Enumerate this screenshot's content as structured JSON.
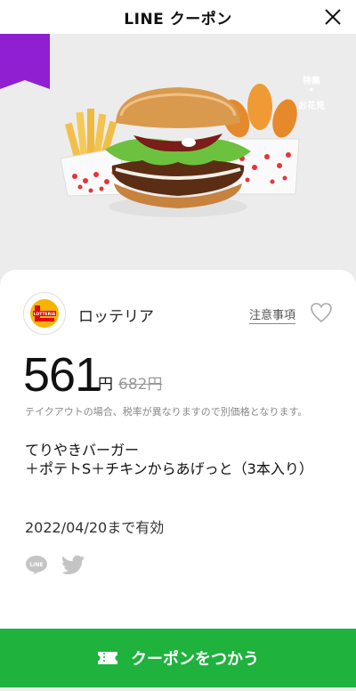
{
  "header": {
    "title": "LINE クーポン"
  },
  "ribbon": {
    "top_text": "特集",
    "star": "★",
    "bottom_text": "お花見"
  },
  "hero": {
    "brand_text": "LOTTERIA"
  },
  "coupon": {
    "shop_name": "ロッテリア",
    "logo_text": "LOTTERIA",
    "notice_label": "注意事項",
    "price": "561",
    "price_unit": "円",
    "original_price": "682円",
    "tax_note": "テイクアウトの場合、税率が異なりますので別価格となります。",
    "product_line1": "てりやきバーガー",
    "product_line2": "＋ポテトS＋チキンからあげっと（3本入り）",
    "expiry": "2022/04/20まで有効"
  },
  "share": {
    "line_icon_text": "LINE"
  },
  "button": {
    "label": "クーポンをつかう"
  },
  "colors": {
    "accent_green": "#1fb23d",
    "ribbon_purple": "#8f1fd0",
    "brand_red": "#e50012"
  },
  "icons": [
    "close-icon",
    "heart-icon",
    "line-icon",
    "twitter-icon",
    "ticket-icon"
  ]
}
